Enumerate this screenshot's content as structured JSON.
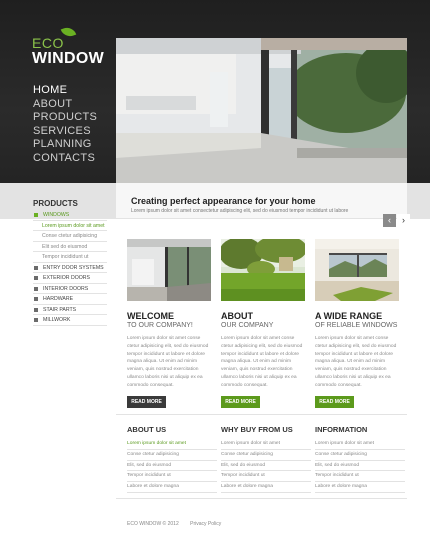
{
  "logo": {
    "eco": "ECO",
    "window": "WINDOW"
  },
  "nav": [
    "HOME",
    "ABOUT",
    "PRODUCTS",
    "SERVICES",
    "PLANNING",
    "CONTACTS"
  ],
  "hero": {
    "title": "Creating perfect appearance for your home",
    "subtitle": "Lorem ipsum dolor sit amet consectetur adipiscing elit, sed do eiusmod tempor incididunt ut labore",
    "prev": "‹",
    "next": "›"
  },
  "sidebar": {
    "title": "PRODUCTS",
    "items": [
      {
        "label": "WINDOWS",
        "type": "main",
        "active": true
      },
      {
        "label": "Lorem ipsum dolor sit amet",
        "type": "sub",
        "active": true
      },
      {
        "label": "Conse ctetur adipisicing",
        "type": "sub",
        "active": false
      },
      {
        "label": "Elit sed do eiusmod",
        "type": "sub",
        "active": false
      },
      {
        "label": "Tempor incididunt ut",
        "type": "sub",
        "active": false
      },
      {
        "label": "ENTRY DOOR SYSTEMS",
        "type": "main",
        "active": false
      },
      {
        "label": "EXTERIOR DOORS",
        "type": "main",
        "active": false
      },
      {
        "label": "INTERIOR DOORS",
        "type": "main",
        "active": false
      },
      {
        "label": "HARDWARE",
        "type": "main",
        "active": false
      },
      {
        "label": "STAIR PARTS",
        "type": "main",
        "active": false
      },
      {
        "label": "MILLWORK",
        "type": "main",
        "active": false
      }
    ]
  },
  "columns": [
    {
      "title": "WELCOME",
      "subtitle": "TO OUR COMPANY!",
      "text": "Lorem ipsum dolor sit amet conse ctetur adipisicing elit, sed do eiusmod tempor incididunt ut labore et dolore magna aliqua. Ut enim ad minim veniam, quis nostrud exercitation ullamco laboris nisi ut aliquip ex ea commodo consequat.",
      "button": "READ MORE",
      "button_style": "dark"
    },
    {
      "title": "ABOUT",
      "subtitle": "OUR COMPANY",
      "text": "Lorem ipsum dolor sit amet conse ctetur adipisicing elit, sed do eiusmod tempor incididunt ut labore et dolore magna aliqua. Ut enim ad minim veniam, quis nostrud exercitation ullamco laboris nisi ut aliquip ex ea commodo consequat.",
      "button": "READ MORE",
      "button_style": "green"
    },
    {
      "title": "A WIDE RANGE",
      "subtitle": "OF RELIABLE WINDOWS",
      "text": "Lorem ipsum dolor sit amet conse ctetur adipisicing elit, sed do eiusmod tempor incididunt ut labore et dolore magna aliqua. Ut enim ad minim veniam, quis nostrud exercitation ullamco laboris nisi ut aliquip ex ea commodo consequat.",
      "button": "READ MORE",
      "button_style": "green"
    }
  ],
  "footer_columns": [
    {
      "title": "ABOUT US",
      "items": [
        "Lorem ipsum dolor sit amet",
        "Conse ctetur adipisicing",
        "Elit, sed do eiusmod",
        "Tempor incididunt ut",
        "Labore et dolore magna"
      ],
      "first_green": true
    },
    {
      "title": "WHY BUY FROM US",
      "items": [
        "Lorem ipsum dolor sit amet",
        "Conse ctetur adipisicing",
        "Elit, sed do eiusmod",
        "Tempor incididunt ut",
        "Labore et dolore magna"
      ],
      "first_green": false
    },
    {
      "title": "INFORMATION",
      "items": [
        "Lorem ipsum dolor sit amet",
        "Conse ctetur adipisicing",
        "Elit, sed do eiusmod",
        "Tempor incididunt ut",
        "Labore et dolore magna"
      ],
      "first_green": false
    }
  ],
  "footer": {
    "copyright": "ECO WINDOW © 2012",
    "privacy": "Privacy Policy"
  },
  "colors": {
    "accent": "#5c9a1c",
    "dark": "#242424"
  }
}
